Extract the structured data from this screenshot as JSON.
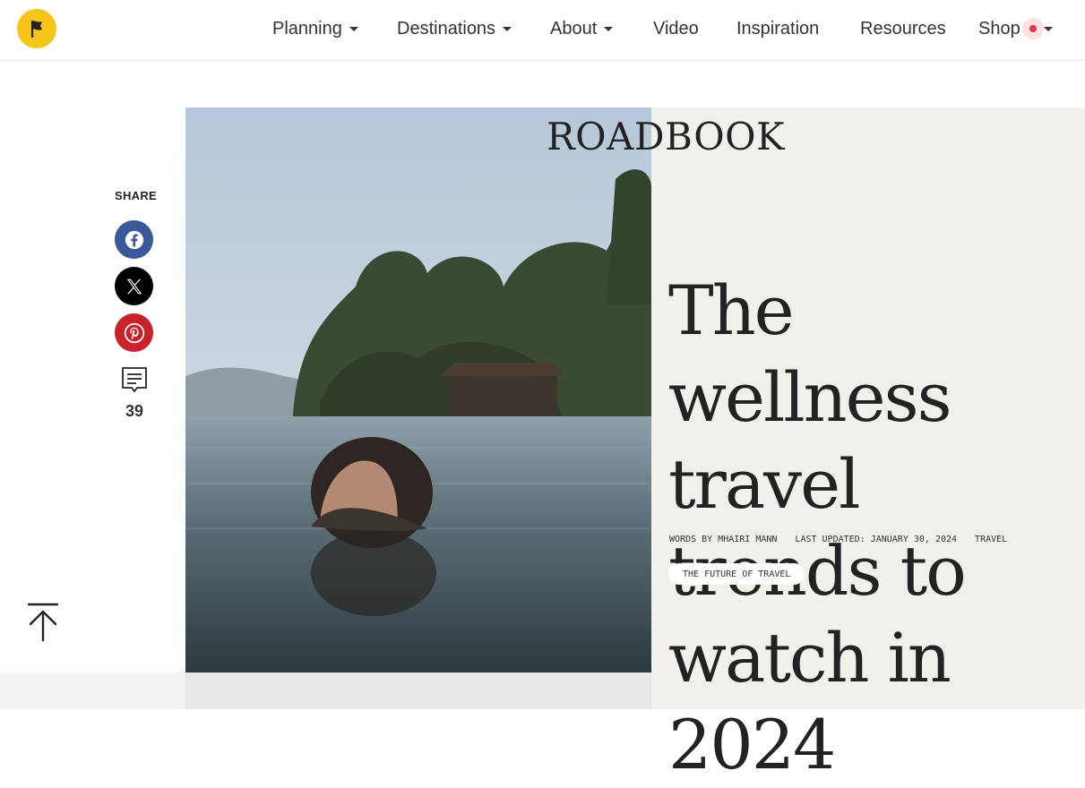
{
  "nav": {
    "items": [
      {
        "label": "Planning",
        "has_dropdown": true
      },
      {
        "label": "Destinations",
        "has_dropdown": true
      },
      {
        "label": "About",
        "has_dropdown": true
      },
      {
        "label": "Video",
        "has_dropdown": false
      },
      {
        "label": "Inspiration",
        "has_dropdown": false
      },
      {
        "label": "Resources",
        "has_dropdown": false
      },
      {
        "label": "Shop",
        "has_dropdown": true
      }
    ],
    "logo_color": "#f5c518"
  },
  "share": {
    "label": "SHARE",
    "buttons": [
      {
        "name": "facebook",
        "color": "#3b5998"
      },
      {
        "name": "x",
        "color": "#000000"
      },
      {
        "name": "pinterest",
        "color": "#c8232c"
      }
    ],
    "comment_count": "39"
  },
  "hero": {
    "brand": "ROADBOOK",
    "headline": "The wellness travel trends to watch in 2024",
    "byline": "WORDS BY MHAIRI MANN",
    "updated": "LAST UPDATED: JANUARY 30, 2024",
    "category": "TRAVEL",
    "tag": "THE FUTURE OF TRAVEL",
    "panel_color": "#f1f0eb"
  }
}
